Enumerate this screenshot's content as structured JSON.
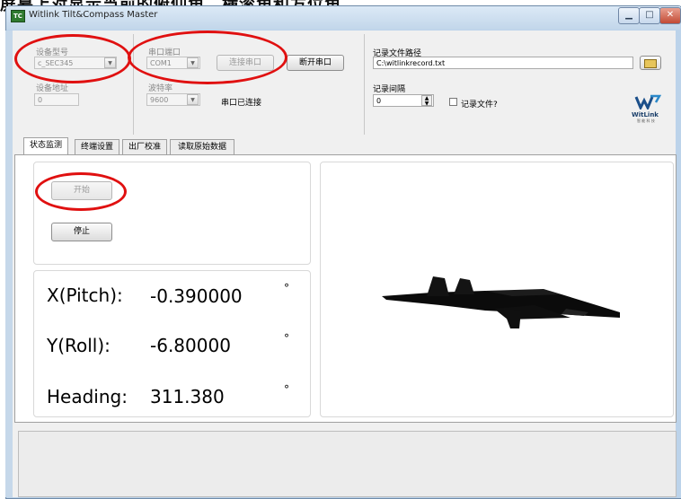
{
  "window": {
    "title": "Witlink Tilt&Compass Master",
    "caption_text": "屏幕上对显示当前的俯仰角、横滚角和方位角。",
    "icon_label": "TC"
  },
  "device": {
    "model_label": "设备型号",
    "model_value": "c_SEC345",
    "address_label": "设备地址",
    "address_value": "0"
  },
  "serial": {
    "port_label": "串口端口",
    "port_value": "COM1",
    "baud_label": "波特率",
    "baud_value": "9600",
    "connect_label": "连接串口",
    "disconnect_label": "断开串口",
    "status_text": "串口已连接"
  },
  "recording": {
    "path_label": "记录文件路径",
    "path_value": "C:\\witlinkrecord.txt",
    "interval_label": "记录间隔",
    "interval_value": "0",
    "record_checkbox_label": "记录文件?"
  },
  "logo": {
    "text": "WitLink",
    "subtext": "智 能 科 技"
  },
  "tabs": [
    {
      "label": "状态监测",
      "active": true
    },
    {
      "label": "终端设置",
      "active": false
    },
    {
      "label": "出厂校准",
      "active": false
    },
    {
      "label": "读取原始数据",
      "active": false
    }
  ],
  "controls": {
    "start_label": "开始",
    "stop_label": "停止"
  },
  "readings": {
    "pitch_label": "X(Pitch):",
    "pitch_value": "-0.390000",
    "roll_label": "Y(Roll):",
    "roll_value": "-6.80000",
    "heading_label": "Heading:",
    "heading_value": "311.380",
    "unit": "°"
  },
  "colors": {
    "highlight": "#e01010",
    "window_frame": "#bcd3ea",
    "background": "#f0f0f0"
  }
}
